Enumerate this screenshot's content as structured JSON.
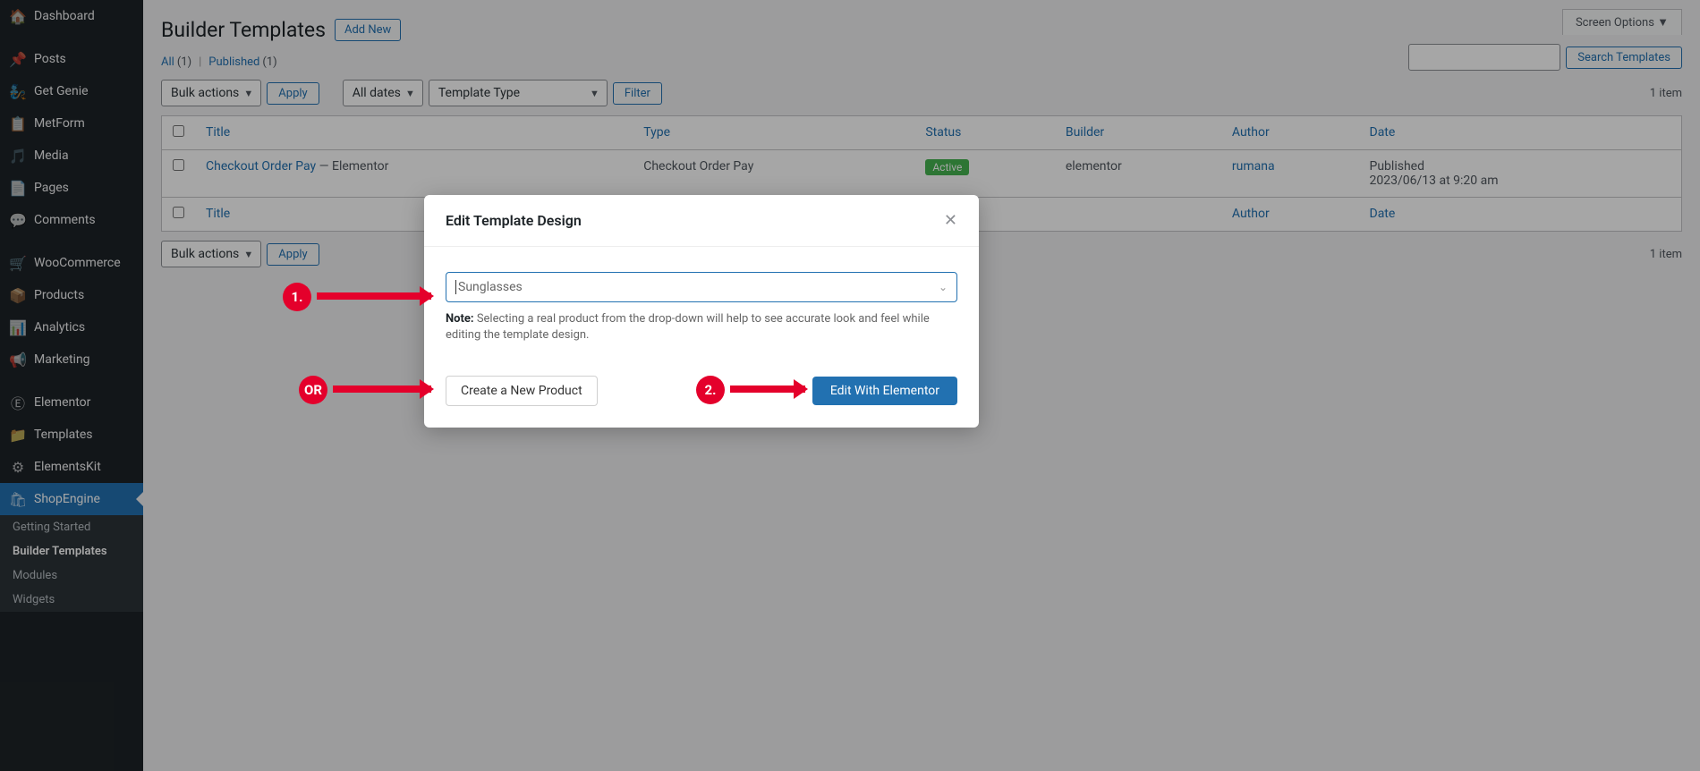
{
  "sidebar": {
    "items": [
      {
        "label": "Dashboard"
      },
      {
        "label": "Posts"
      },
      {
        "label": "Get Genie"
      },
      {
        "label": "MetForm"
      },
      {
        "label": "Media"
      },
      {
        "label": "Pages"
      },
      {
        "label": "Comments"
      },
      {
        "label": "WooCommerce"
      },
      {
        "label": "Products"
      },
      {
        "label": "Analytics"
      },
      {
        "label": "Marketing"
      },
      {
        "label": "Elementor"
      },
      {
        "label": "Templates"
      },
      {
        "label": "ElementsKit"
      },
      {
        "label": "ShopEngine"
      }
    ],
    "subitems": [
      {
        "label": "Getting Started"
      },
      {
        "label": "Builder Templates"
      },
      {
        "label": "Modules"
      },
      {
        "label": "Widgets"
      }
    ]
  },
  "header": {
    "title": "Builder Templates",
    "add_new": "Add New",
    "screen_options": "Screen Options  ▼"
  },
  "views": {
    "all": "All",
    "all_count": "(1)",
    "published": "Published",
    "published_count": "(1)",
    "sep": "|"
  },
  "search": {
    "button": "Search Templates"
  },
  "filters": {
    "bulk": "Bulk actions",
    "apply": "Apply",
    "dates": "All dates",
    "type": "Template Type",
    "filter": "Filter"
  },
  "item_count": "1 item",
  "table": {
    "cols": {
      "title": "Title",
      "type": "Type",
      "status": "Status",
      "builder": "Builder",
      "author": "Author",
      "date": "Date"
    },
    "row": {
      "title_link": "Checkout Order Pay",
      "title_suffix": " — Elementor",
      "type": "Checkout Order Pay",
      "status": "Active",
      "builder": "elementor",
      "author": "rumana",
      "date_label": "Published",
      "date_value": "2023/06/13 at 9:20 am"
    }
  },
  "modal": {
    "title": "Edit Template Design",
    "product_placeholder": "Sunglasses",
    "note_prefix": "Note:",
    "note_text": " Selecting a real product from the drop-down will help to see accurate look and feel while editing the template design.",
    "create": "Create a New Product",
    "edit": "Edit With Elementor"
  },
  "annotations": {
    "one": "1.",
    "two": "2.",
    "or": "OR"
  }
}
